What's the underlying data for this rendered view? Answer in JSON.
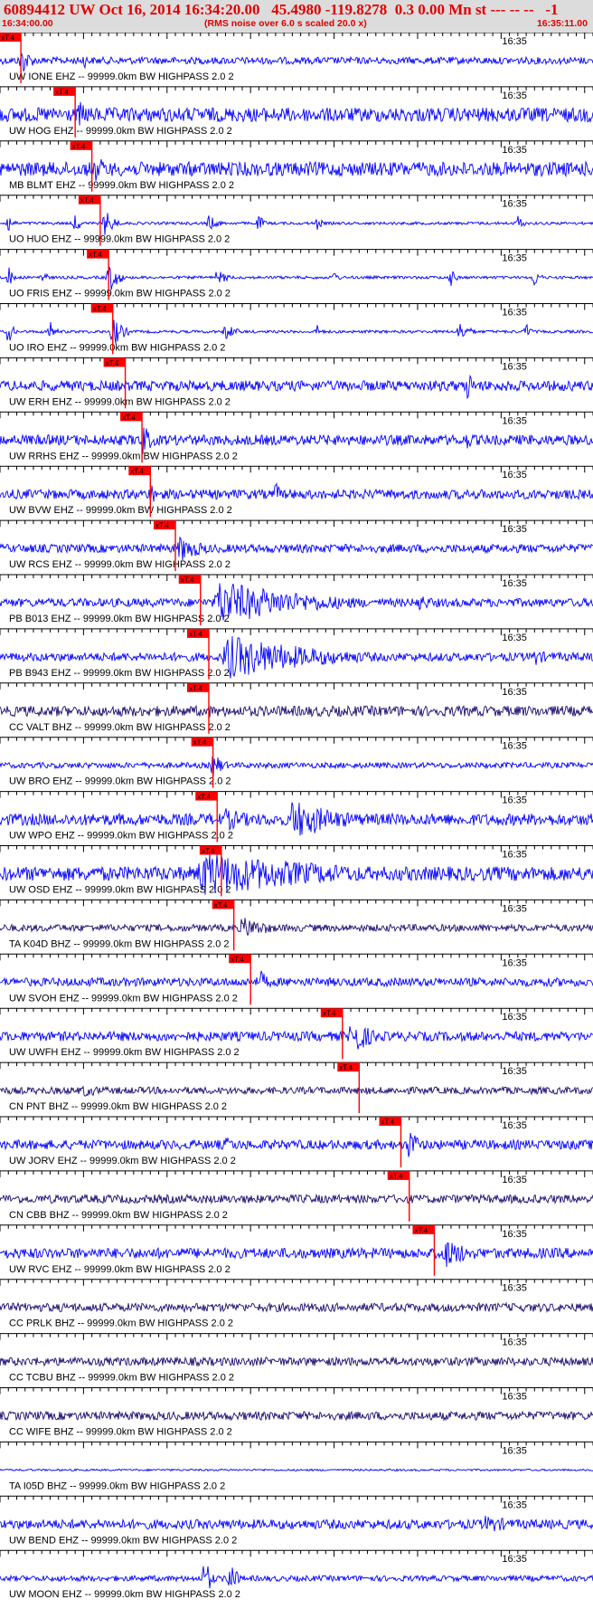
{
  "header": {
    "title": "60894412 UW Oct 16, 2014 16:34:20.00   45.4980 -119.8278  0.3 0.00 Mn st --- -- --   -1",
    "start_time": "16:34:00.00",
    "noise_note": "(RMS noise over 6.0 s scaled 20.0 x)",
    "end_time": "16:35:11.00"
  },
  "colors": {
    "trace": "#0000ff",
    "trace_dark": "#1a0a6e",
    "pick": "#ff0000",
    "axis": "#000000",
    "header_text": "#e00000",
    "header_bg": "#dcdcdc"
  },
  "chart_data": {
    "type": "line",
    "title": "",
    "x_range": [
      "16:34:00.00",
      "16:35:11.00"
    ],
    "minute_tick_label": "16:35",
    "pick_label": "xT.4",
    "grid": false,
    "series": [
      {
        "name": "UW IONE EHZ -- 99999.0km BW  HIGHPASS  2.0  2",
        "pick": "16:34:02.5",
        "amplitude": 0.15,
        "color": "trace",
        "events": [
          {
            "t": "16:34:02.5",
            "amp": 0.7,
            "dur": 2
          },
          {
            "t": "16:34:10",
            "amp": 0.4,
            "dur": 1
          }
        ]
      },
      {
        "name": "UW HOG EHZ -- 99999.0km BW  HIGHPASS  2.0  2",
        "pick": "16:34:09",
        "amplitude": 0.3,
        "color": "trace",
        "events": [
          {
            "t": "16:34:09.5",
            "amp": 0.6,
            "dur": 3
          }
        ]
      },
      {
        "name": "MB BLMT EHZ -- 99999.0km BW  HIGHPASS  2.0  2",
        "pick": "16:34:11",
        "amplitude": 0.3,
        "color": "trace",
        "events": [
          {
            "t": "16:34:11.5",
            "amp": 0.6,
            "dur": 3
          }
        ]
      },
      {
        "name": "UO HUO EHZ -- 99999.0km BW  HIGHPASS  2.0  2",
        "pick": "16:34:12",
        "amplitude": 0.06,
        "color": "trace",
        "events": [
          {
            "t": "16:34:01",
            "amp": 0.45,
            "dur": 1
          },
          {
            "t": "16:34:09",
            "amp": 0.5,
            "dur": 1
          },
          {
            "t": "16:34:12.5",
            "amp": 0.6,
            "dur": 2
          },
          {
            "t": "16:34:25",
            "amp": 0.35,
            "dur": 2
          },
          {
            "t": "16:34:31",
            "amp": 0.4,
            "dur": 1
          },
          {
            "t": "16:34:38",
            "amp": 0.3,
            "dur": 1
          },
          {
            "t": "16:35:02",
            "amp": 0.4,
            "dur": 1
          }
        ]
      },
      {
        "name": "UO FRIS EHZ -- 99999.0km BW  HIGHPASS  2.0  2",
        "pick": "16:34:13",
        "amplitude": 0.06,
        "color": "trace",
        "events": [
          {
            "t": "16:34:01",
            "amp": 0.5,
            "dur": 1
          },
          {
            "t": "16:34:05",
            "amp": 0.4,
            "dur": 1
          },
          {
            "t": "16:34:13",
            "amp": 0.7,
            "dur": 2
          },
          {
            "t": "16:34:26",
            "amp": 0.35,
            "dur": 2
          },
          {
            "t": "16:34:40",
            "amp": 0.3,
            "dur": 1
          },
          {
            "t": "16:34:54",
            "amp": 0.4,
            "dur": 1
          },
          {
            "t": "16:35:04",
            "amp": 0.45,
            "dur": 1
          }
        ]
      },
      {
        "name": "UO IRO EHZ -- 99999.0km BW  HIGHPASS  2.0  2",
        "pick": "16:34:13.5",
        "amplitude": 0.06,
        "color": "trace",
        "events": [
          {
            "t": "16:34:01",
            "amp": 0.55,
            "dur": 1
          },
          {
            "t": "16:34:06",
            "amp": 0.5,
            "dur": 1
          },
          {
            "t": "16:34:13.5",
            "amp": 0.7,
            "dur": 2
          },
          {
            "t": "16:34:27",
            "amp": 0.4,
            "dur": 2
          },
          {
            "t": "16:34:38",
            "amp": 0.3,
            "dur": 1
          },
          {
            "t": "16:34:55",
            "amp": 0.45,
            "dur": 2
          },
          {
            "t": "16:35:03",
            "amp": 0.4,
            "dur": 1
          }
        ]
      },
      {
        "name": "UW ERH EHZ -- 99999.0km BW  HIGHPASS  2.0  2",
        "pick": "16:34:15",
        "amplitude": 0.22,
        "color": "trace",
        "events": [
          {
            "t": "16:34:56",
            "amp": 0.8,
            "dur": 1
          }
        ]
      },
      {
        "name": "UW RRHS EHZ -- 99999.0km BW  HIGHPASS  2.0  2",
        "pick": "16:34:17",
        "amplitude": 0.22,
        "color": "trace",
        "events": [
          {
            "t": "16:34:17",
            "amp": 0.8,
            "dur": 2
          },
          {
            "t": "16:34:56",
            "amp": 0.5,
            "dur": 1
          }
        ]
      },
      {
        "name": "UW BVW EHZ -- 99999.0km BW  HIGHPASS  2.0  2",
        "pick": "16:34:18",
        "amplitude": 0.2,
        "color": "trace",
        "events": [
          {
            "t": "16:34:18",
            "amp": 0.5,
            "dur": 2
          },
          {
            "t": "16:34:33",
            "amp": 0.6,
            "dur": 1
          }
        ]
      },
      {
        "name": "UW RCS EHZ -- 99999.0km BW  HIGHPASS  2.0  2",
        "pick": "16:34:21",
        "amplitude": 0.18,
        "color": "trace",
        "events": [
          {
            "t": "16:34:21.5",
            "amp": 0.6,
            "dur": 5
          }
        ]
      },
      {
        "name": "PB B013 EHZ -- 99999.0km BW  HIGHPASS  2.0  2",
        "pick": "16:34:24",
        "amplitude": 0.18,
        "color": "trace",
        "events": [
          {
            "t": "16:34:26",
            "amp": 1.0,
            "dur": 18
          },
          {
            "t": "16:34:50",
            "amp": 0.4,
            "dur": 4
          }
        ]
      },
      {
        "name": "PB B943 EHZ -- 99999.0km BW  HIGHPASS  2.0  2",
        "pick": "16:34:25",
        "amplitude": 0.18,
        "color": "trace",
        "events": [
          {
            "t": "16:34:27",
            "amp": 1.0,
            "dur": 18
          },
          {
            "t": "16:35:04",
            "amp": 0.4,
            "dur": 3
          }
        ]
      },
      {
        "name": "CC VALT BHZ -- 99999.0km BW  HIGHPASS  2.0  2",
        "pick": "16:34:25",
        "amplitude": 0.22,
        "color": "trace_dark",
        "events": [
          {
            "t": "16:34:25",
            "amp": 0.3,
            "dur": 2
          }
        ]
      },
      {
        "name": "UW BRO EHZ -- 99999.0km BW  HIGHPASS  2.0  2",
        "pick": "16:34:25.5",
        "amplitude": 0.12,
        "color": "trace",
        "events": [
          {
            "t": "16:34:25.5",
            "amp": 0.6,
            "dur": 2
          }
        ]
      },
      {
        "name": "UW WPO EHZ -- 99999.0km BW  HIGHPASS  2.0  2",
        "pick": "16:34:26",
        "amplitude": 0.25,
        "color": "trace",
        "events": [
          {
            "t": "16:34:27",
            "amp": 0.5,
            "dur": 7
          },
          {
            "t": "16:34:35",
            "amp": 0.9,
            "dur": 10
          }
        ]
      },
      {
        "name": "UW OSD EHZ -- 99999.0km BW  HIGHPASS  2.0  2",
        "pick": "16:34:26.5",
        "amplitude": 0.3,
        "color": "trace",
        "events": [
          {
            "t": "16:34:24",
            "amp": 1.0,
            "dur": 28
          }
        ]
      },
      {
        "name": "TA K04D BHZ -- 99999.0km BW  HIGHPASS  2.0  2",
        "pick": "16:34:28",
        "amplitude": 0.15,
        "color": "trace_dark",
        "events": [
          {
            "t": "16:34:29",
            "amp": 0.5,
            "dur": 6
          }
        ]
      },
      {
        "name": "UW SVOH EHZ -- 99999.0km BW  HIGHPASS  2.0  2",
        "pick": "16:34:30",
        "amplitude": 0.18,
        "color": "trace",
        "events": [
          {
            "t": "16:34:31",
            "amp": 0.6,
            "dur": 2
          }
        ]
      },
      {
        "name": "UW UWFH EHZ -- 99999.0km BW  HIGHPASS  2.0  2",
        "pick": "16:34:41",
        "amplitude": 0.2,
        "color": "trace",
        "events": [
          {
            "t": "16:34:42",
            "amp": 0.9,
            "dur": 4
          }
        ]
      },
      {
        "name": "CN PNT BHZ -- 99999.0km BW  HIGHPASS  2.0  2",
        "pick": "16:34:43",
        "amplitude": 0.15,
        "color": "trace_dark",
        "events": [
          {
            "t": "16:34:10",
            "amp": 0.3,
            "dur": 5
          }
        ]
      },
      {
        "name": "UW JORV EHZ -- 99999.0km BW  HIGHPASS  2.0  2",
        "pick": "16:34:48",
        "amplitude": 0.2,
        "color": "trace",
        "events": [
          {
            "t": "16:34:27",
            "amp": 0.35,
            "dur": 4
          },
          {
            "t": "16:34:49",
            "amp": 0.8,
            "dur": 2
          }
        ]
      },
      {
        "name": "CN CBB BHZ -- 99999.0km BW  HIGHPASS  2.0  2",
        "pick": "16:34:49",
        "amplitude": 0.18,
        "color": "trace_dark",
        "events": []
      },
      {
        "name": "UW RVC EHZ -- 99999.0km BW  HIGHPASS  2.0  2",
        "pick": "16:34:52",
        "amplitude": 0.22,
        "color": "trace",
        "events": [
          {
            "t": "16:34:53",
            "amp": 0.7,
            "dur": 6
          }
        ]
      },
      {
        "name": "CC PRLK BHZ -- 99999.0km BW  HIGHPASS  2.0  2",
        "pick": null,
        "amplitude": 0.18,
        "color": "trace_dark",
        "events": []
      },
      {
        "name": "CC TCBU BHZ -- 99999.0km BW  HIGHPASS  2.0  2",
        "pick": null,
        "amplitude": 0.18,
        "color": "trace_dark",
        "events": []
      },
      {
        "name": "CC WIFE BHZ -- 99999.0km BW  HIGHPASS  2.0  2",
        "pick": null,
        "amplitude": 0.18,
        "color": "trace_dark",
        "events": []
      },
      {
        "name": "TA I05D BHZ -- 99999.0km BW  HIGHPASS  2.0  2",
        "pick": null,
        "amplitude": 0.04,
        "color": "trace",
        "events": []
      },
      {
        "name": "UW BEND EHZ -- 99999.0km BW  HIGHPASS  2.0  2",
        "pick": null,
        "amplitude": 0.2,
        "color": "trace",
        "events": [
          {
            "t": "16:34:58",
            "amp": 0.4,
            "dur": 8
          }
        ]
      },
      {
        "name": "UW MOON EHZ -- 99999.0km BW  HIGHPASS  2.0  2",
        "pick": null,
        "amplitude": 0.12,
        "color": "trace",
        "events": [
          {
            "t": "16:34:24.5",
            "amp": 1.0,
            "dur": 1.2
          },
          {
            "t": "16:34:27.5",
            "amp": 1.0,
            "dur": 1.2
          }
        ]
      }
    ]
  }
}
